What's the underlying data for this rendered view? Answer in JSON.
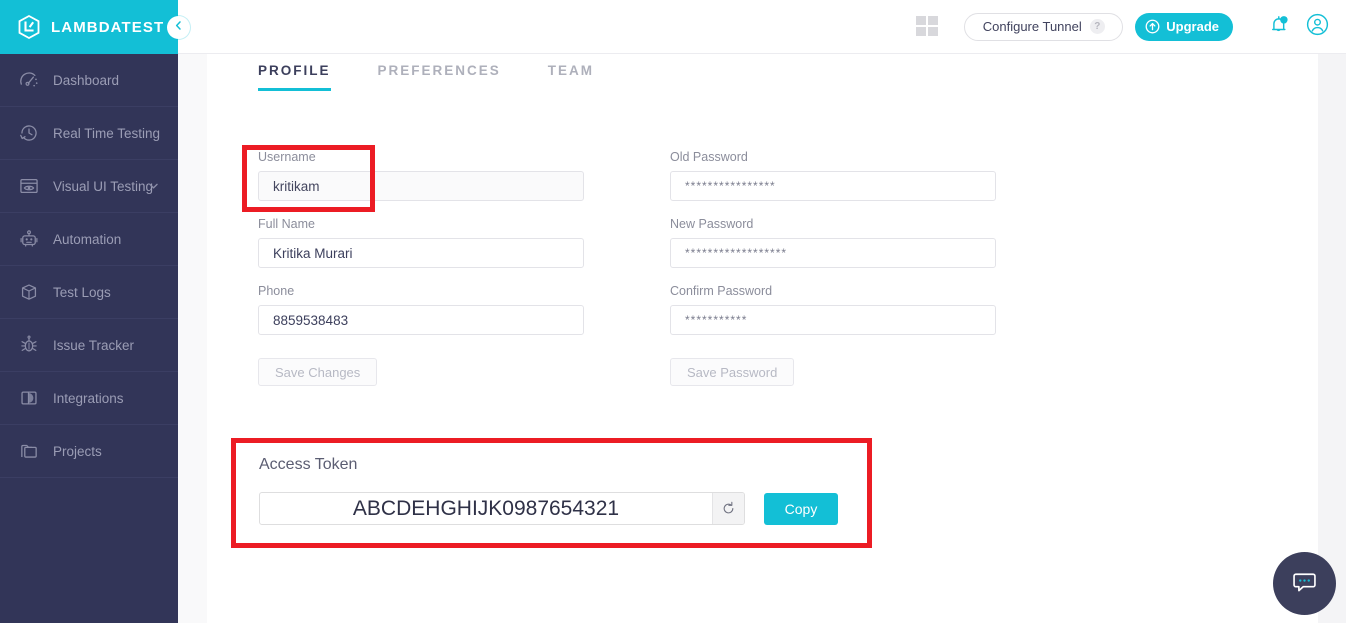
{
  "brand": {
    "name": "LAMBDATEST",
    "logo_icon": "lambdatest-hexagon-logo",
    "collapse_icon": "chevron-left-icon",
    "bg_color": "#13bfd6"
  },
  "sidebar": {
    "bg_color": "#323558",
    "items": [
      {
        "label": "Dashboard",
        "icon": "speedometer-icon",
        "has_caret": false
      },
      {
        "label": "Real Time Testing",
        "icon": "clock-arrow-icon",
        "has_caret": false
      },
      {
        "label": "Visual UI Testing",
        "icon": "browser-eye-icon",
        "has_caret": true
      },
      {
        "label": "Automation",
        "icon": "robot-icon",
        "has_caret": false
      },
      {
        "label": "Test Logs",
        "icon": "box-icon",
        "has_caret": false
      },
      {
        "label": "Issue Tracker",
        "icon": "bug-icon",
        "has_caret": false
      },
      {
        "label": "Integrations",
        "icon": "puzzle-circle-icon",
        "has_caret": false
      },
      {
        "label": "Projects",
        "icon": "folder-icon",
        "has_caret": false
      }
    ]
  },
  "topbar": {
    "grid_icon": "apps-grid-icon",
    "configure_tunnel_label": "Configure Tunnel",
    "tunnel_help_label": "?",
    "upgrade_label": "Upgrade",
    "upgrade_icon": "arrow-up-circle-icon",
    "notification_icon": "bell-icon",
    "account_icon": "user-avatar-icon",
    "accent_color": "#13bfd6"
  },
  "tabs": [
    {
      "label": "PROFILE",
      "active": true
    },
    {
      "label": "PREFERENCES",
      "active": false
    },
    {
      "label": "TEAM",
      "active": false
    }
  ],
  "profile_form": {
    "left": {
      "username": {
        "label": "Username",
        "value": "kritikam",
        "disabled": true,
        "highlighted": true
      },
      "full_name": {
        "label": "Full Name",
        "value": "Kritika Murari"
      },
      "phone": {
        "label": "Phone",
        "value": "8859538483"
      },
      "save_label": "Save Changes"
    },
    "right": {
      "old_password": {
        "label": "Old Password",
        "value": "****************"
      },
      "new_password": {
        "label": "New Password",
        "value": "******************"
      },
      "confirm_password": {
        "label": "Confirm Password",
        "value": "***********"
      },
      "save_label": "Save Password"
    }
  },
  "access_token": {
    "title": "Access Token",
    "value": "ABCDEHGHIJK0987654321",
    "refresh_icon": "refresh-icon",
    "copy_label": "Copy",
    "highlight_color": "#ec1c24"
  },
  "chat": {
    "icon": "chat-bubble-icon",
    "bg_color": "#3c3f5c"
  }
}
